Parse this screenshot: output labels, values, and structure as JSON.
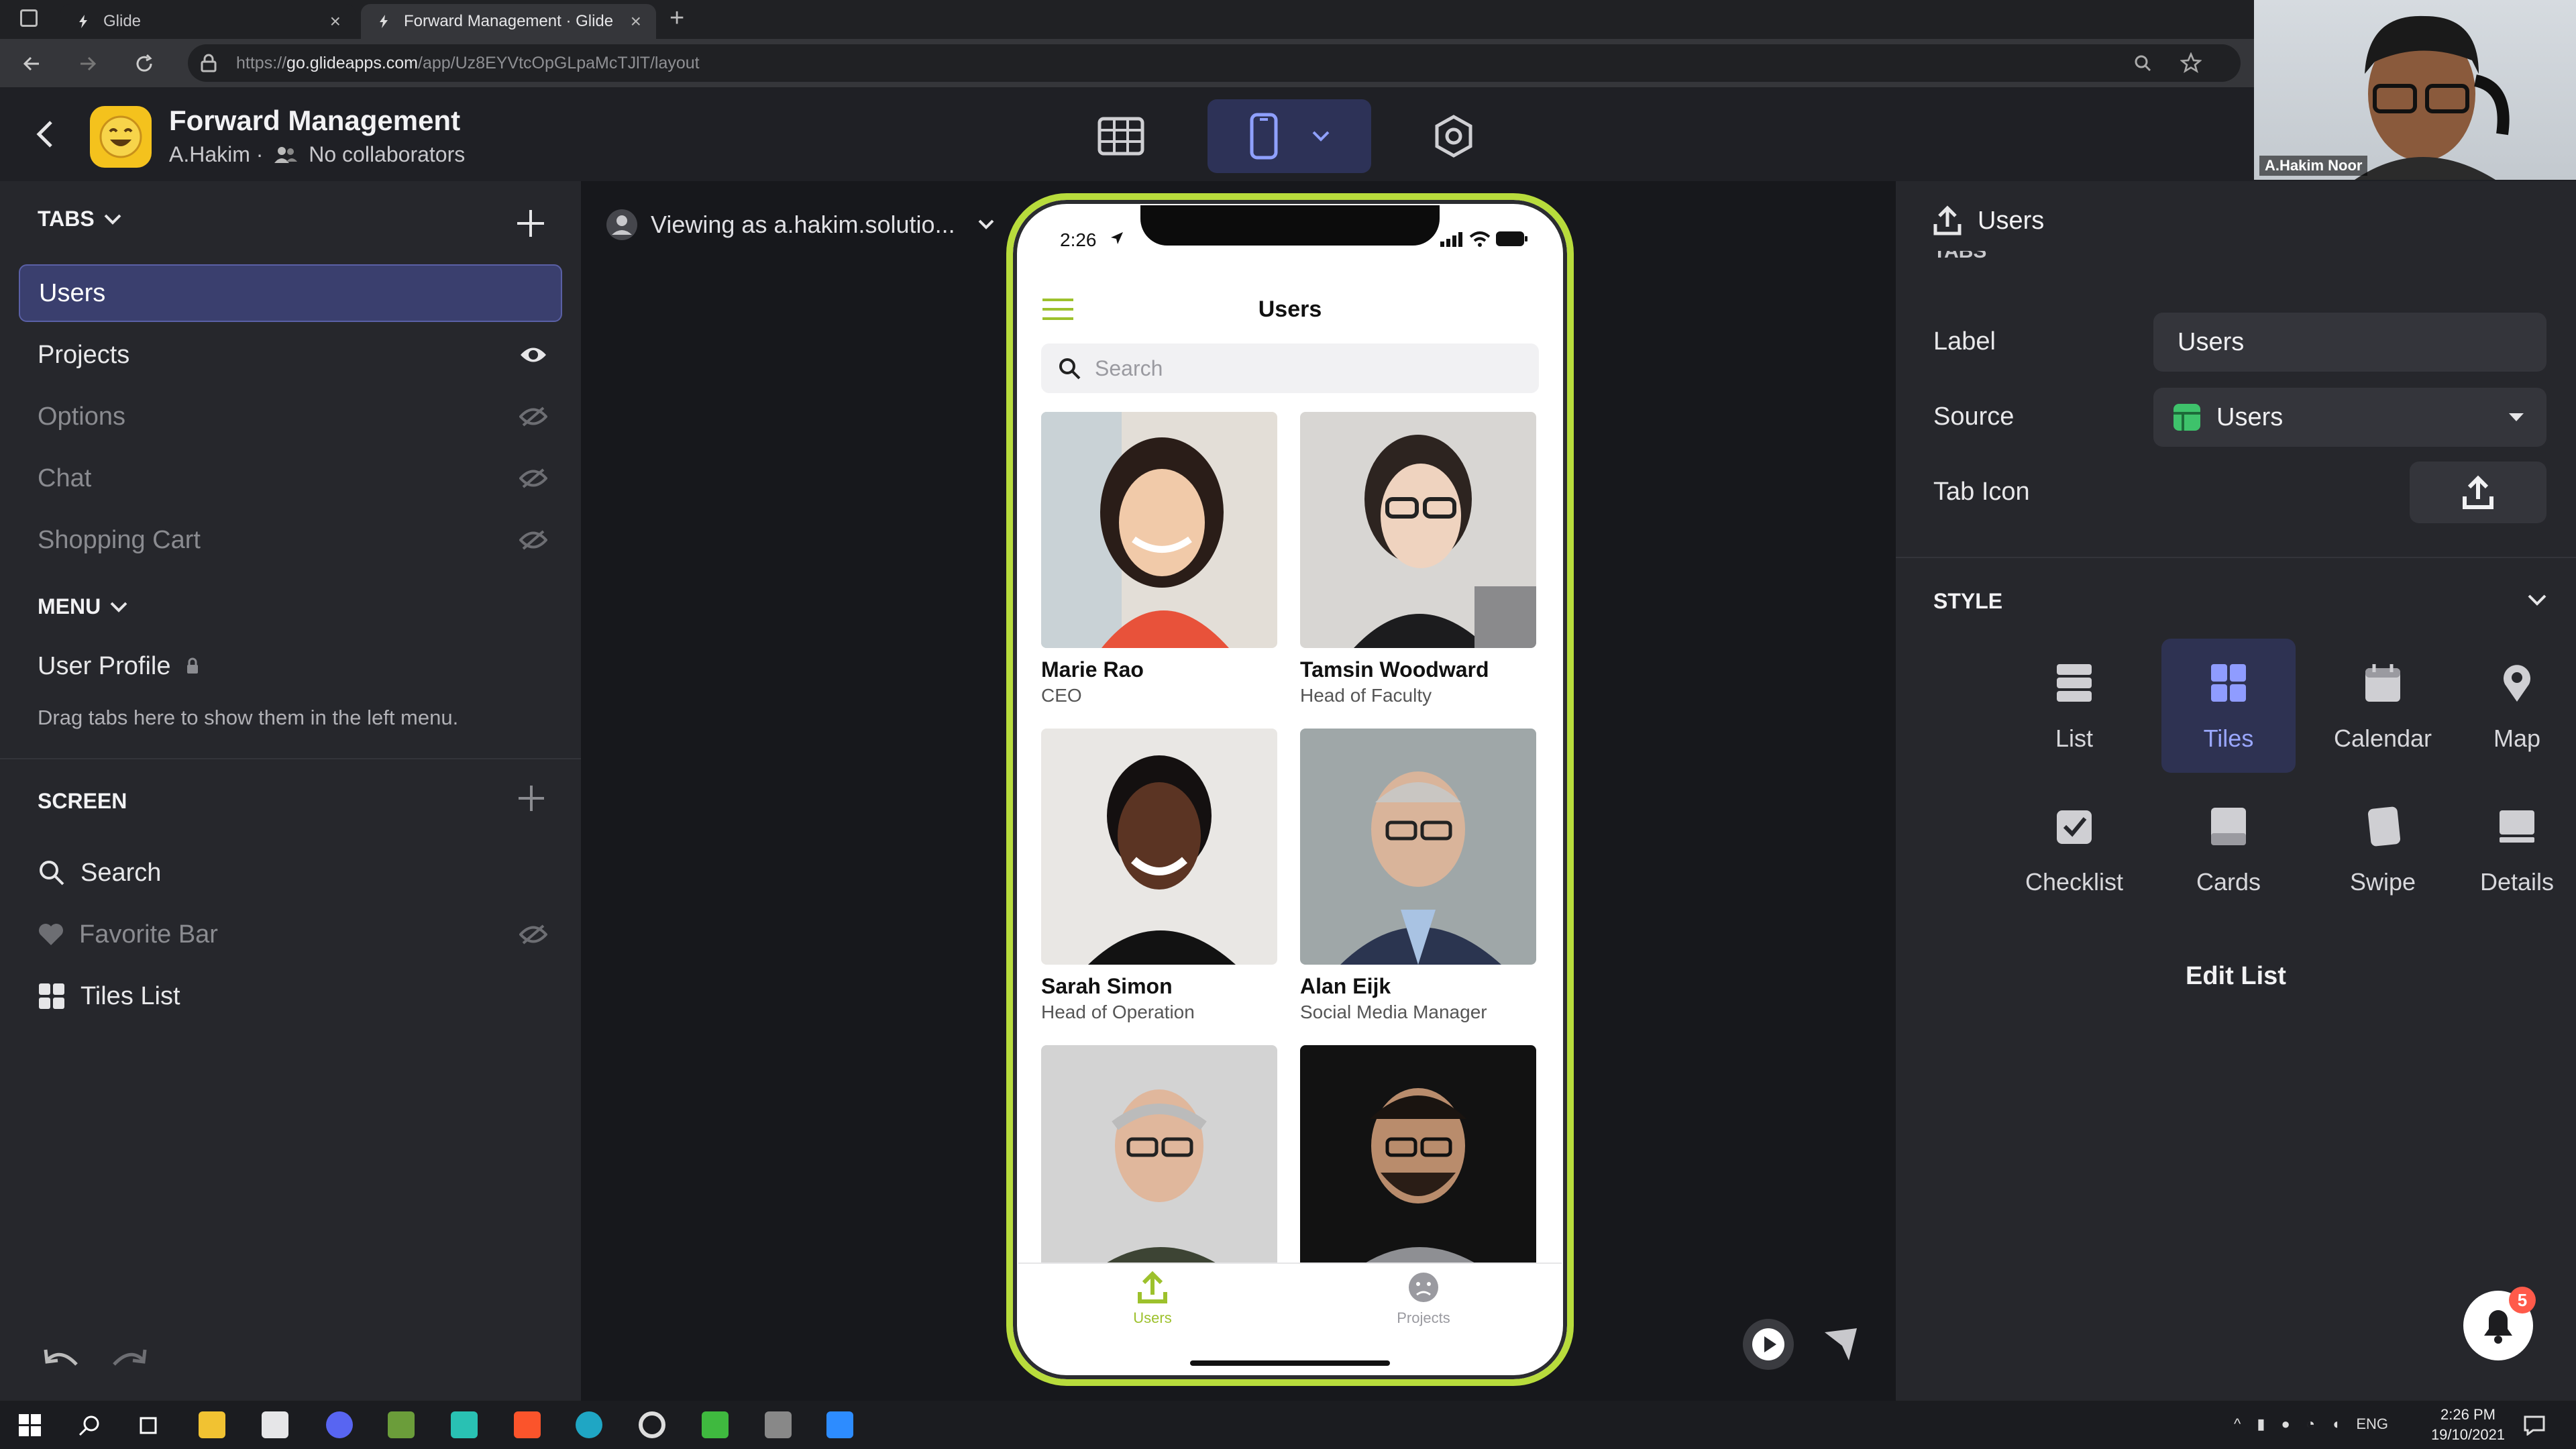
{
  "browser": {
    "tabs": [
      {
        "title": "Glide"
      },
      {
        "title": "Forward Management · Glide"
      }
    ],
    "url_prefix": "https://",
    "url_domain": "go.glideapps.com",
    "url_path": "/app/Uz8EYVtcOpGLpaMcTJlT/layout"
  },
  "app": {
    "title": "Forward Management",
    "owner": "A.Hakim",
    "collaborators": "No collaborators"
  },
  "video": {
    "name": "A.Hakim Noor"
  },
  "left": {
    "tabs_header": "TABS",
    "tabs": [
      {
        "label": "Users",
        "icon": "none"
      },
      {
        "label": "Projects",
        "icon": "eye-icon"
      },
      {
        "label": "Options",
        "icon": "eye-off-icon"
      },
      {
        "label": "Chat",
        "icon": "eye-off-icon"
      },
      {
        "label": "Shopping Cart",
        "icon": "eye-off-icon"
      }
    ],
    "menu_header": "MENU",
    "menu_item": "User Profile",
    "menu_hint": "Drag tabs here to show them in the left menu.",
    "screen_header": "SCREEN",
    "screen_items": [
      {
        "label": "Search",
        "icon": "search-icon"
      },
      {
        "label": "Favorite Bar",
        "icon": "heart-icon"
      },
      {
        "label": "Tiles List",
        "icon": "grid-icon"
      }
    ]
  },
  "canvas": {
    "viewing_as": "Viewing as a.hakim.solutio..."
  },
  "phone": {
    "time": "2:26",
    "screen_title": "Users",
    "search_placeholder": "Search",
    "users": [
      {
        "name": "Marie Rao",
        "role": "CEO"
      },
      {
        "name": "Tamsin Woodward",
        "role": "Head of Faculty"
      },
      {
        "name": "Sarah Simon",
        "role": "Head of Operation"
      },
      {
        "name": "Alan Eijk",
        "role": "Social Media Manager"
      },
      {
        "name": "",
        "role": ""
      },
      {
        "name": "",
        "role": ""
      }
    ],
    "bottom_tabs": [
      {
        "label": "Users"
      },
      {
        "label": "Projects"
      }
    ]
  },
  "right": {
    "panel_title": "Users",
    "tabs_section_fragment": "TABS",
    "label_label": "Label",
    "label_value": "Users",
    "source_label": "Source",
    "source_value": "Users",
    "tabicon_label": "Tab Icon",
    "style_header": "STYLE",
    "styles": [
      {
        "label": "List"
      },
      {
        "label": "Tiles"
      },
      {
        "label": "Calendar"
      },
      {
        "label": "Map"
      },
      {
        "label": "Checklist"
      },
      {
        "label": "Cards"
      },
      {
        "label": "Swipe"
      },
      {
        "label": "Details"
      }
    ],
    "selected_style": "Tiles",
    "edit_list": "Edit List",
    "notification_count": "5"
  },
  "taskbar": {
    "lang": "ENG",
    "time": "2:26 PM",
    "date": "19/10/2021"
  },
  "colors": {
    "accent": "#b8dc3c",
    "selection": "#3a3f6e",
    "panel": "#26272c",
    "canvas": "#17181c"
  }
}
